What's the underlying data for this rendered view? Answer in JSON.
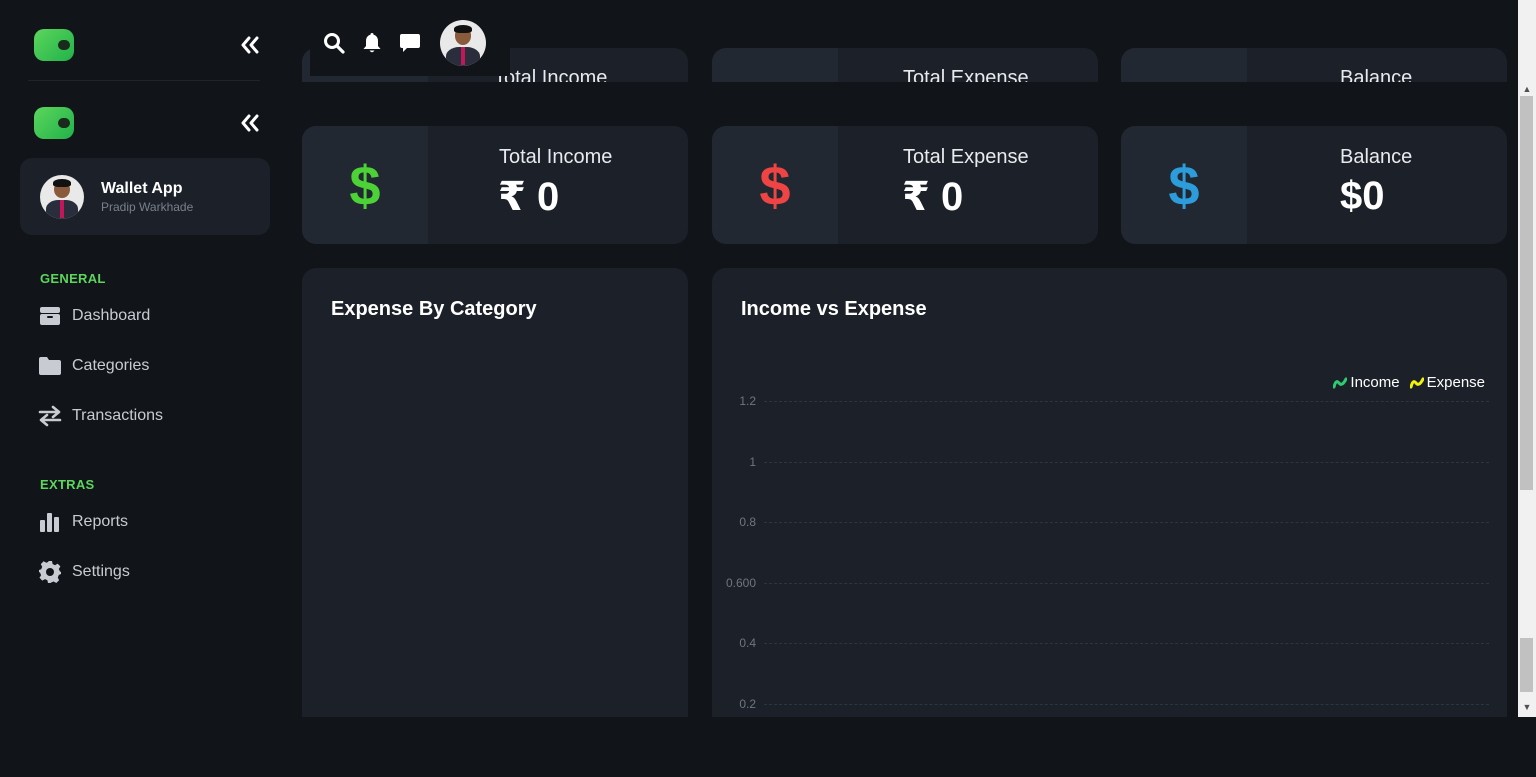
{
  "sidebar": {
    "app_name": "Wallet App",
    "user_name": "Pradip Warkhade",
    "sections": [
      {
        "title": "GENERAL",
        "items": [
          {
            "label": "Dashboard",
            "icon": "dashboard-icon"
          },
          {
            "label": "Categories",
            "icon": "folder-icon"
          },
          {
            "label": "Transactions",
            "icon": "transfer-arrows-icon"
          }
        ]
      },
      {
        "title": "EXTRAS",
        "items": [
          {
            "label": "Reports",
            "icon": "bar-chart-icon"
          },
          {
            "label": "Settings",
            "icon": "gear-icon"
          }
        ]
      }
    ]
  },
  "topbar": {
    "icons": [
      "search-icon",
      "bell-icon",
      "chat-icon"
    ]
  },
  "stats": [
    {
      "title": "Total Income",
      "value": "₹ 0",
      "icon": "dollar-icon",
      "color": "#4cd137"
    },
    {
      "title": "Total Expense",
      "value": "₹ 0",
      "icon": "dollar-icon",
      "color": "#ef4444"
    },
    {
      "title": "Balance",
      "value": "$0",
      "icon": "dollar-icon",
      "color": "#2d9cdb"
    }
  ],
  "panels": {
    "expense_by_category": {
      "title": "Expense By Category"
    },
    "income_vs_expense": {
      "title": "Income vs Expense"
    }
  },
  "chart_data": {
    "type": "line",
    "title": "Income vs Expense",
    "series": [
      {
        "name": "Income",
        "color": "#2ecc71",
        "values": []
      },
      {
        "name": "Expense",
        "color": "#f1f10a",
        "values": []
      }
    ],
    "yticks": [
      "1.2",
      "1",
      "0.8",
      "0.600",
      "0.4",
      "0.2"
    ],
    "ytick_values": [
      1.2,
      1,
      0.8,
      0.6,
      0.4,
      0.2
    ],
    "legend": "top-right",
    "grid": true
  },
  "colors": {
    "background": "#111419",
    "card": "#1b2029",
    "accent": "#5cd65c"
  }
}
